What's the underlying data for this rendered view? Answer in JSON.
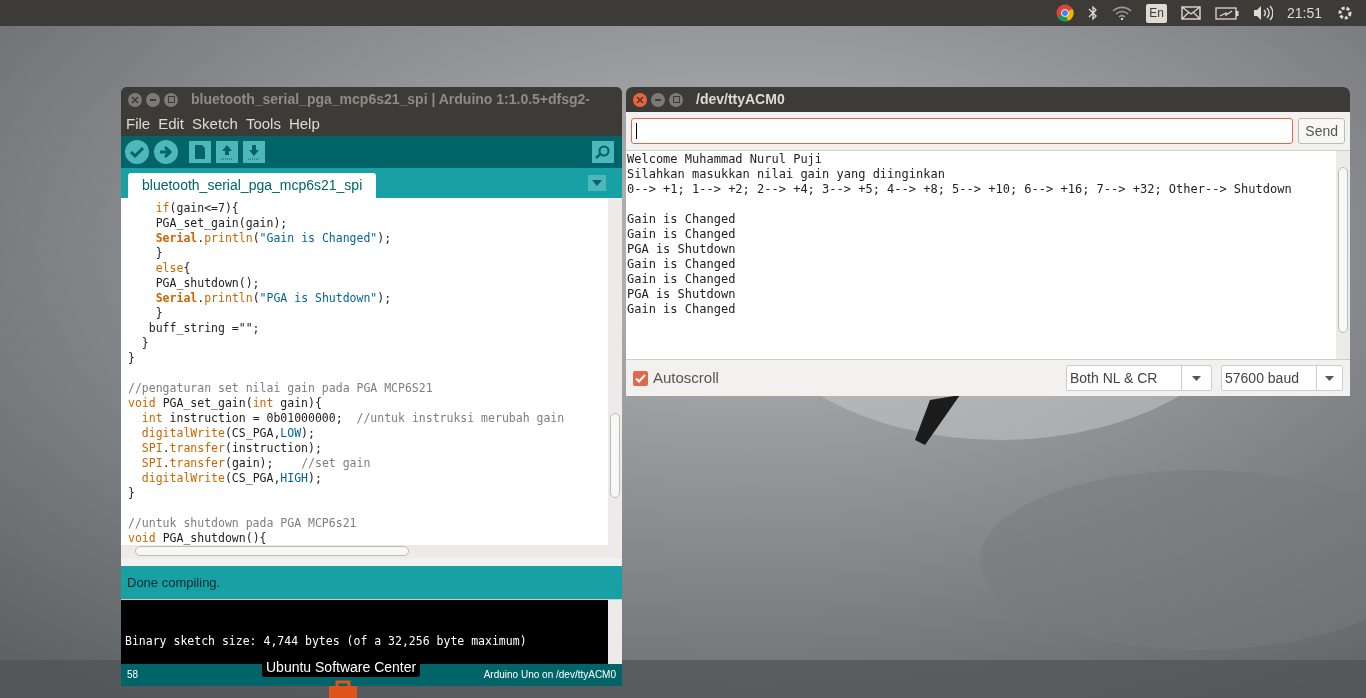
{
  "top_panel": {
    "keyboard_layout": "En",
    "clock": "21:51"
  },
  "arduino_window": {
    "title": "bluetooth_serial_pga_mcp6s21_spi | Arduino 1:1.0.5+dfsg2-",
    "menu": [
      "File",
      "Edit",
      "Sketch",
      "Tools",
      "Help"
    ],
    "tabs": [
      {
        "label": "bluetooth_serial_pga_mcp6s21_spi",
        "selected": true
      }
    ],
    "code_blocks": [
      [
        [
          {
            "kind": "keyword",
            "text": "    if"
          },
          {
            "kind": "plain",
            "text": "(gain<=7){"
          }
        ],
        [
          {
            "kind": "plain",
            "text": "    PGA_set_gain(gain);"
          }
        ],
        [
          {
            "kind": "class",
            "text": "    Serial"
          },
          {
            "kind": "plain",
            "text": "."
          },
          {
            "kind": "keyword",
            "text": "println"
          },
          {
            "kind": "plain",
            "text": "("
          },
          {
            "kind": "string",
            "text": "\"Gain is Changed\""
          },
          {
            "kind": "plain",
            "text": ");"
          }
        ],
        [
          {
            "kind": "plain",
            "text": "    }"
          }
        ],
        [
          {
            "kind": "keyword",
            "text": "    else"
          },
          {
            "kind": "plain",
            "text": "{"
          }
        ],
        [
          {
            "kind": "plain",
            "text": "    PGA_shutdown();"
          }
        ],
        [
          {
            "kind": "class",
            "text": "    Serial"
          },
          {
            "kind": "plain",
            "text": "."
          },
          {
            "kind": "keyword",
            "text": "println"
          },
          {
            "kind": "plain",
            "text": "("
          },
          {
            "kind": "string",
            "text": "\"PGA is Shutdown\""
          },
          {
            "kind": "plain",
            "text": ");"
          }
        ],
        [
          {
            "kind": "plain",
            "text": "    }"
          }
        ],
        [
          {
            "kind": "plain",
            "text": "   buff_string =\"\";"
          }
        ],
        [
          {
            "kind": "plain",
            "text": "  }"
          }
        ],
        [
          {
            "kind": "plain",
            "text": "}"
          }
        ]
      ],
      [
        [
          {
            "kind": "comment",
            "text": "//pengaturan set nilai gain pada PGA MCP6S21"
          }
        ],
        [
          {
            "kind": "keyword",
            "text": "void"
          },
          {
            "kind": "plain",
            "text": " PGA_set_gain("
          },
          {
            "kind": "keyword",
            "text": "int"
          },
          {
            "kind": "plain",
            "text": " gain){"
          }
        ],
        [
          {
            "kind": "keyword",
            "text": "  int"
          },
          {
            "kind": "plain",
            "text": " instruction = 0b01000000;  "
          },
          {
            "kind": "comment",
            "text": "//untuk instruksi merubah gain"
          }
        ],
        [
          {
            "kind": "keyword",
            "text": "  digitalWrite"
          },
          {
            "kind": "plain",
            "text": "(CS_PGA,"
          },
          {
            "kind": "constant",
            "text": "LOW"
          },
          {
            "kind": "plain",
            "text": ");"
          }
        ],
        [
          {
            "kind": "keyword",
            "text": "  SPI"
          },
          {
            "kind": "plain",
            "text": "."
          },
          {
            "kind": "keyword",
            "text": "transfer"
          },
          {
            "kind": "plain",
            "text": "(instruction);"
          }
        ],
        [
          {
            "kind": "keyword",
            "text": "  SPI"
          },
          {
            "kind": "plain",
            "text": "."
          },
          {
            "kind": "keyword",
            "text": "transfer"
          },
          {
            "kind": "plain",
            "text": "(gain);    "
          },
          {
            "kind": "comment",
            "text": "//set gain"
          }
        ],
        [
          {
            "kind": "keyword",
            "text": "  digitalWrite"
          },
          {
            "kind": "plain",
            "text": "(CS_PGA,"
          },
          {
            "kind": "constant",
            "text": "HIGH"
          },
          {
            "kind": "plain",
            "text": ");"
          }
        ],
        [
          {
            "kind": "plain",
            "text": "}"
          }
        ]
      ],
      [
        [
          {
            "kind": "comment",
            "text": "//untuk shutdown pada PGA MCP6s21"
          }
        ],
        [
          {
            "kind": "keyword",
            "text": "void"
          },
          {
            "kind": "plain",
            "text": " PGA_shutdown(){"
          }
        ]
      ]
    ],
    "status": "Done compiling.",
    "console": [
      "Binary sketch size: 4,744 bytes (of a 32,256 byte maximum)"
    ],
    "line_number": "58",
    "board": "Arduino Uno on /dev/ttyACM0"
  },
  "serial_monitor": {
    "title": "/dev/ttyACM0",
    "send_button": "Send",
    "output_blocks": [
      [
        "Welcome Muhammad Nurul Puji",
        "Silahkan masukkan nilai gain yang diinginkan",
        "0--> +1; 1--> +2; 2--> +4; 3--> +5; 4--> +8; 5--> +10; 6--> +16; 7--> +32; Other--> Shutdown"
      ],
      [
        "Gain is Changed",
        "Gain is Changed",
        "PGA is Shutdown",
        "Gain is Changed",
        "Gain is Changed",
        "PGA is Shutdown",
        "Gain is Changed"
      ]
    ],
    "autoscroll": {
      "label": "Autoscroll",
      "checked": true
    },
    "line_ending": "Both NL & CR",
    "baud_rate": "57600 baud"
  },
  "tooltip": "Ubuntu Software Center"
}
